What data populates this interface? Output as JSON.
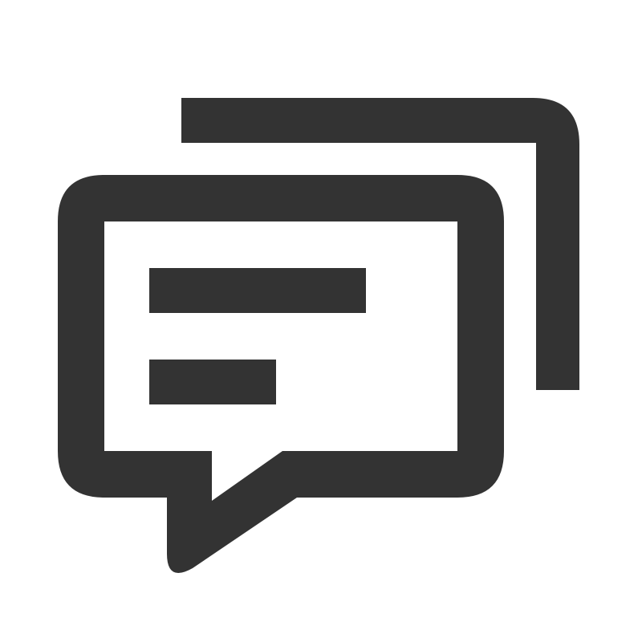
{
  "icon": {
    "name": "chat-bubbles-icon",
    "color": "#333333",
    "background": "#ffffff"
  }
}
